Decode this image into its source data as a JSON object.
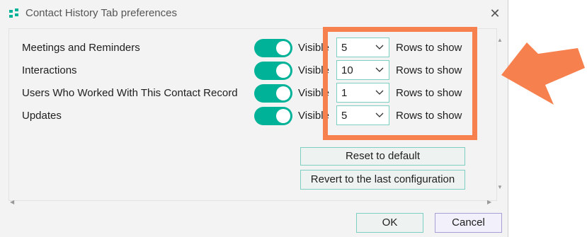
{
  "dialog": {
    "title": "Contact History Tab preferences",
    "close_glyph": "✕",
    "app_icon": "app-logo-icon"
  },
  "rows": [
    {
      "label": "Meetings and Reminders",
      "visible_label": "Visible",
      "enabled": true,
      "rows_value": "5",
      "rows_label": "Rows to show"
    },
    {
      "label": "Interactions",
      "visible_label": "Visible",
      "enabled": true,
      "rows_value": "10",
      "rows_label": "Rows to show"
    },
    {
      "label": "Users Who Worked With This Contact Record",
      "visible_label": "Visible",
      "enabled": true,
      "rows_value": "1",
      "rows_label": "Rows to show"
    },
    {
      "label": "Updates",
      "visible_label": "Visible",
      "enabled": true,
      "rows_value": "5",
      "rows_label": "Rows to show"
    }
  ],
  "actions": {
    "reset_label": "Reset to default",
    "revert_label": "Revert to the last configuration"
  },
  "footer": {
    "ok_label": "OK",
    "cancel_label": "Cancel"
  },
  "scroll_glyphs": {
    "up": "▲",
    "down": "▼",
    "left": "◀",
    "right": "▶"
  },
  "colors": {
    "toggle_on": "#00b398",
    "highlight": "#f7804f",
    "button_border": "#7ccfc1"
  }
}
